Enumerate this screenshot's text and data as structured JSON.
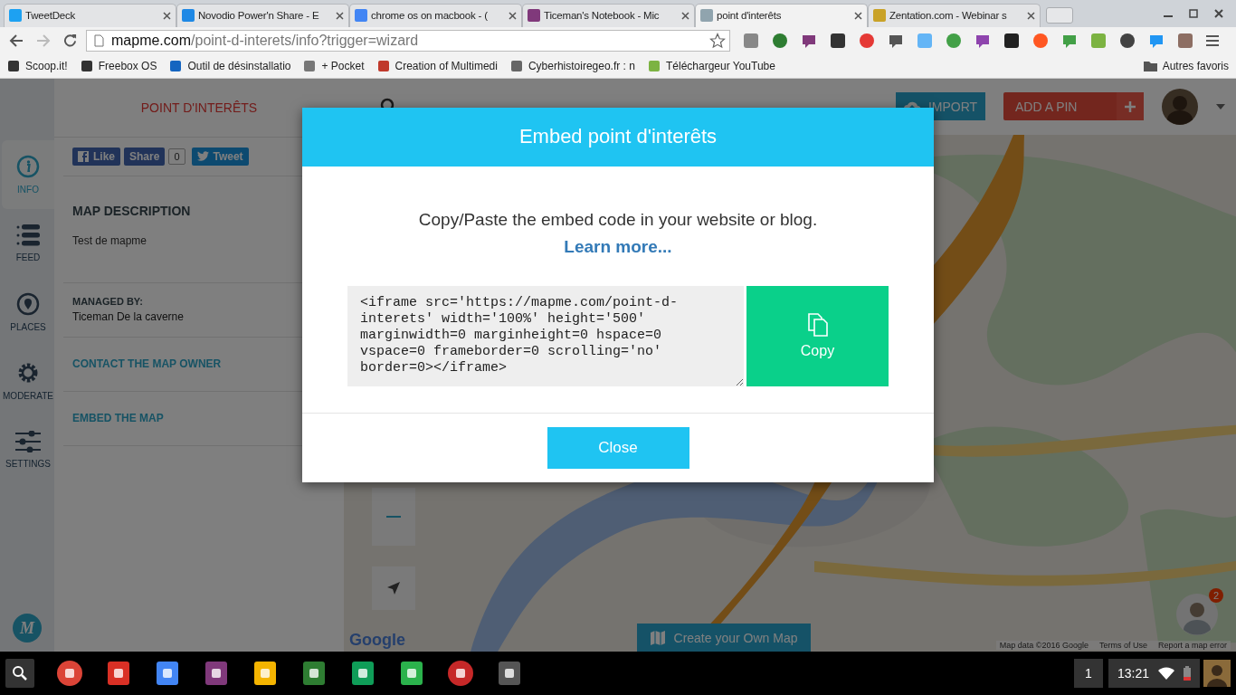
{
  "browser": {
    "tabs": [
      {
        "title": "TweetDeck",
        "selected": false,
        "color": "#1da1f2"
      },
      {
        "title": "Novodio Power'n Share - E",
        "selected": false,
        "color": "#1e88e5"
      },
      {
        "title": "chrome os on macbook - (",
        "selected": false,
        "color": "#4285f4"
      },
      {
        "title": "Ticeman's Notebook - Mic",
        "selected": false,
        "color": "#80397b"
      },
      {
        "title": "point d'interêts",
        "selected": true,
        "color": "#90a4ae"
      },
      {
        "title": "Zentation.com - Webinar s",
        "selected": false,
        "color": "#c9a227"
      }
    ],
    "address": {
      "domain": "mapme.com",
      "path": "/point-d-interets/info?trigger=wizard"
    },
    "bookmarks": [
      "Scoop.it!",
      "Freebox OS",
      "Outil de désinstallatio",
      "+ Pocket",
      "Creation of Multimedi",
      "Cyberhistoiregeo.fr : n",
      "Téléchargeur YouTube"
    ],
    "other_bookmarks": "Autres favoris"
  },
  "sidebar": {
    "items": [
      {
        "label": "INFO",
        "kind": "info",
        "selected": true
      },
      {
        "label": "FEED",
        "kind": "feed",
        "selected": false
      },
      {
        "label": "PLACES",
        "kind": "places",
        "selected": false
      },
      {
        "label": "MODERATE",
        "kind": "moderate",
        "selected": false
      },
      {
        "label": "SETTINGS",
        "kind": "settings",
        "selected": false
      }
    ],
    "logo": "M"
  },
  "panel": {
    "title": "POINT D'INTERÊTS",
    "like": "Like",
    "share": "Share",
    "share_count": "0",
    "tweet": "Tweet",
    "description_heading": "MAP DESCRIPTION",
    "description": "Test de mapme",
    "managed_by_label": "MANAGED BY:",
    "managed_by": "Ticeman De la caverne",
    "links": [
      "CONTACT THE MAP OWNER",
      "EMBED THE MAP"
    ]
  },
  "map_header": {
    "import": "IMPORT",
    "add_pin": "ADD A PIN"
  },
  "map": {
    "google": "Google",
    "create_button": "Create your Own Map",
    "attribution": "Map data ©2016 Google",
    "terms": "Terms of Use",
    "report": "Report a map error",
    "chat_badge": "2"
  },
  "modal": {
    "title": "Embed point d'interêts",
    "instruction": "Copy/Paste the embed code in your website or blog.",
    "learn_more": "Learn more...",
    "embed_code": "<iframe src='https://mapme.com/point-d-interets' width='100%' height='500' marginwidth=0 marginheight=0 hspace=0 vspace=0 frameborder=0 scrolling='no' border=0></iframe>",
    "copy": "Copy",
    "close": "Close"
  },
  "taskbar": {
    "window_count": "1",
    "time": "13:21"
  }
}
